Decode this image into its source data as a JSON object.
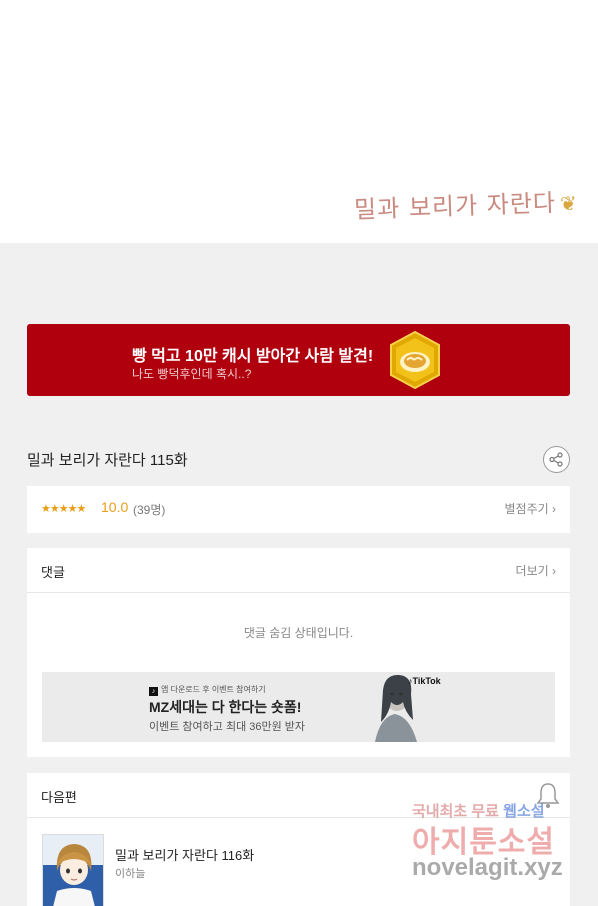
{
  "viewer": {
    "end_signature": "밀과 보리가 자란다",
    "end_signature_icon": "wheat-sprig-icon"
  },
  "promo_banner": {
    "title": "빵 먹고 10만 캐시 받아간 사람 발견!",
    "subtitle": "나도 빵덕후인데 혹시..?",
    "background": "#b0000e",
    "icon": "bread-coin-icon"
  },
  "episode": {
    "title": "밀과 보리가 자란다 115화",
    "share_icon": "share-icon"
  },
  "rating": {
    "stars": "★★★★★",
    "score": "10.0",
    "count": "(39명)",
    "rate_link": "별점주기",
    "accent": "#ea9e17"
  },
  "comments": {
    "header": "댓글",
    "more_link": "더보기",
    "hidden_message": "댓글 숨김 상태입니다."
  },
  "ad": {
    "top_line": "앱 다운로드 후 이벤트 참여하기",
    "title": "MZ세대는 다 한다는 숏폼!",
    "subtitle": "이벤트 참여하고 최대 36만원 받자",
    "brand": "TikTok"
  },
  "next_episode": {
    "header": "다음편",
    "title": "밀과 보리가 자란다 116화",
    "author": "이하늘",
    "bell_icon": "bell-icon"
  },
  "watermark": {
    "line1_prefix": "국내최초 무료",
    "line1_highlight": "웹소설",
    "line2": "아지툰소설",
    "line3": "novelagit.xyz"
  }
}
